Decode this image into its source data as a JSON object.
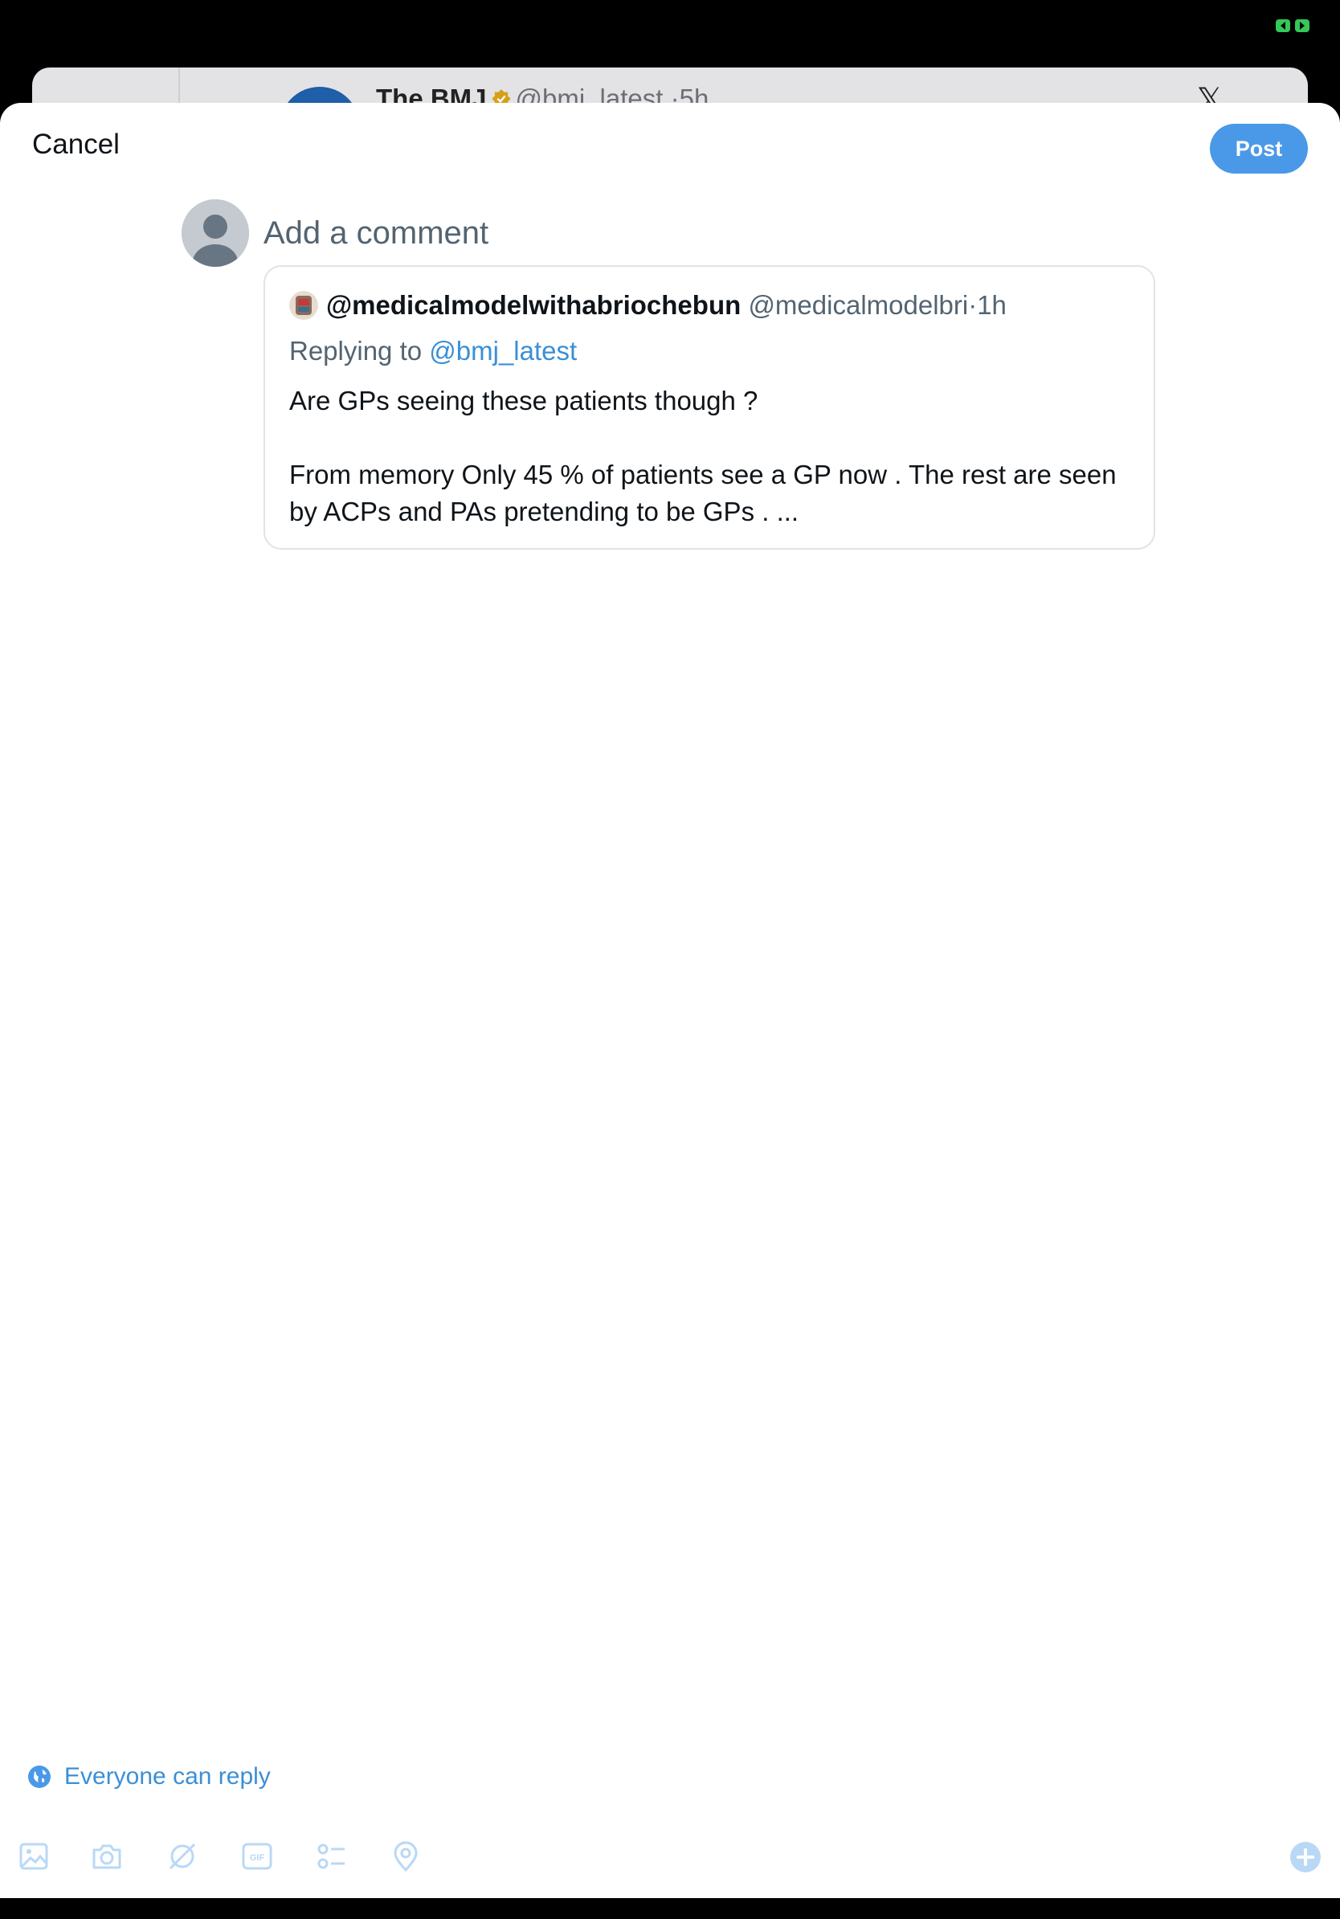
{
  "background_post": {
    "name": "The BMJ",
    "handle": "@bmj_latest",
    "separator": "·",
    "time": "5h",
    "x_logo": "𝕏"
  },
  "header": {
    "cancel_label": "Cancel",
    "post_label": "Post"
  },
  "composer": {
    "placeholder": "Add a comment"
  },
  "quoted_post": {
    "display_name": "@medicalmodelwithabriochebun",
    "handle": "@medicalmodelbri",
    "separator": "·",
    "time": "1h",
    "replying_prefix": "Replying to",
    "replying_to": "@bmj_latest",
    "text_line1": "Are GPs seeing these patients though ?",
    "text_line2": "From memory Only 45 % of patients see a GP now . The rest are seen by ACPs and PAs pretending to be GPs . ..."
  },
  "reply_setting": {
    "label": "Everyone can reply",
    "icon": "globe-icon"
  },
  "toolbar": {
    "icons": [
      "image-icon",
      "camera-icon",
      "grok-icon",
      "gif-icon",
      "poll-icon",
      "location-icon",
      "add-thread-icon"
    ],
    "gif_text": "GIF"
  },
  "colors": {
    "accent": "#4a99e9",
    "link": "#3b8fd6",
    "secondary_text": "#536471",
    "toolbar_icon": "#b9d8f6"
  }
}
